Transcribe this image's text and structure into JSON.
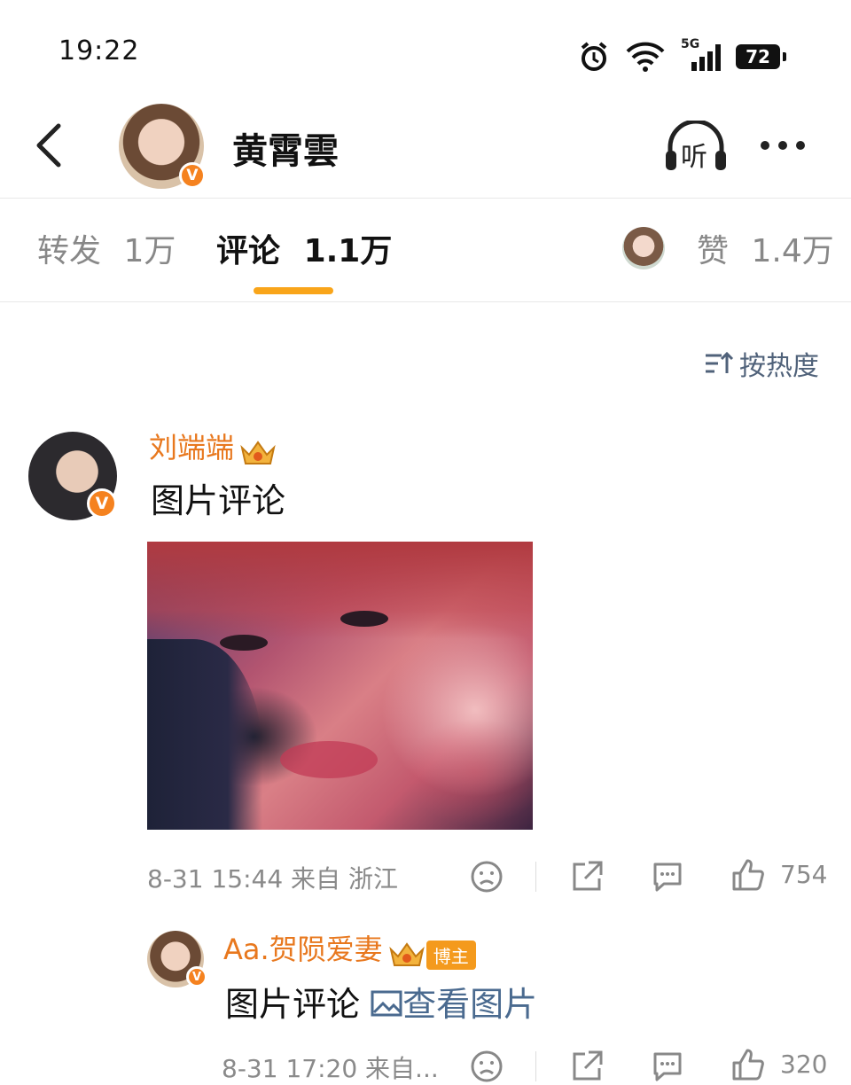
{
  "status_bar": {
    "time": "19:22",
    "battery": "72",
    "network": "5G"
  },
  "header": {
    "title": "黄霄雲",
    "listen_label": "听"
  },
  "tabs": [
    {
      "label": "转发",
      "count": "1万"
    },
    {
      "label": "评论",
      "count": "1.1万"
    },
    {
      "label": "赞",
      "count": "1.4万"
    }
  ],
  "sort": {
    "label": "按热度"
  },
  "comment": {
    "username": "刘端端",
    "text": "图片评论",
    "meta": "8-31 15:44 来自 浙江",
    "likes": "754"
  },
  "reply": {
    "username": "Aa.贺陨爱妻",
    "badge": "博主",
    "text": "图片评论",
    "link": "查看图片",
    "meta": "8-31 17:20 来自...",
    "likes": "320"
  },
  "colors": {
    "accent_orange": "#f9a51a",
    "username": "#e8781e",
    "link": "#4a6a8f"
  },
  "badges": {
    "verified": "V"
  }
}
